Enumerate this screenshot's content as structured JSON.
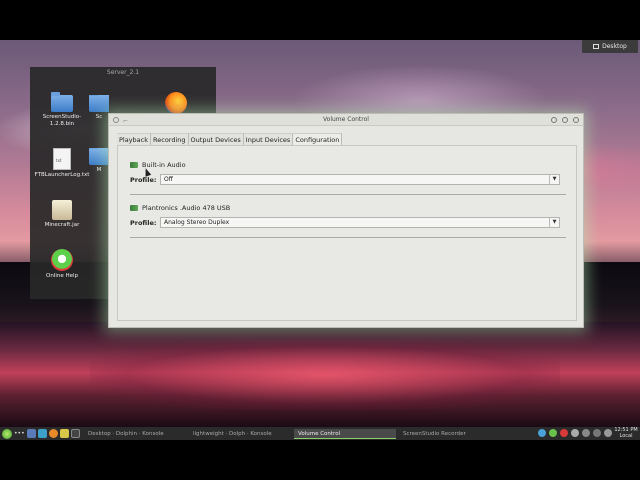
{
  "desktop": {
    "button_label": "Desktop",
    "folder_view": {
      "title": "Server_2.1",
      "items": [
        {
          "label": "ScreenStudio-1.2.8.bin",
          "icon": "folder-icon"
        },
        {
          "label": "Sc",
          "icon": "folder-icon"
        },
        {
          "label": "",
          "icon": "firefox-icon"
        },
        {
          "label": "FTBLauncherLog.txt",
          "icon": "text-file-icon"
        },
        {
          "label": "M",
          "icon": "folder-icon"
        },
        {
          "label": "Minecraft.jar",
          "icon": "jar-file-icon"
        },
        {
          "label": "Online Help",
          "icon": "help-icon"
        }
      ]
    }
  },
  "window": {
    "title": "Volume Control",
    "tabs": [
      "Playback",
      "Recording",
      "Output Devices",
      "Input Devices",
      "Configuration"
    ],
    "active_tab": "Configuration",
    "devices": [
      {
        "name": "Built-in Audio",
        "profile_label": "Profile:",
        "profile_value": "Off"
      },
      {
        "name": "Plantronics .Audio 478 USB",
        "profile_label": "Profile:",
        "profile_value": "Analog Stereo Duplex"
      }
    ]
  },
  "taskbar": {
    "tasks": [
      {
        "label": "Desktop · Dolphin · Konsole",
        "active": false
      },
      {
        "label": "lightweight · Dolph · Konsole",
        "active": false
      },
      {
        "label": "Volume Control",
        "active": true
      },
      {
        "label": "ScreenStudio Recorder",
        "active": false
      }
    ],
    "clock_time": "12:51 PM",
    "clock_date": "Local"
  },
  "colors": {
    "window_bg": "#e6e6e2",
    "window_glow": "#b4f0b4",
    "taskbar_bg": "#2b2b2b",
    "active_task_accent": "#8ad06a"
  }
}
